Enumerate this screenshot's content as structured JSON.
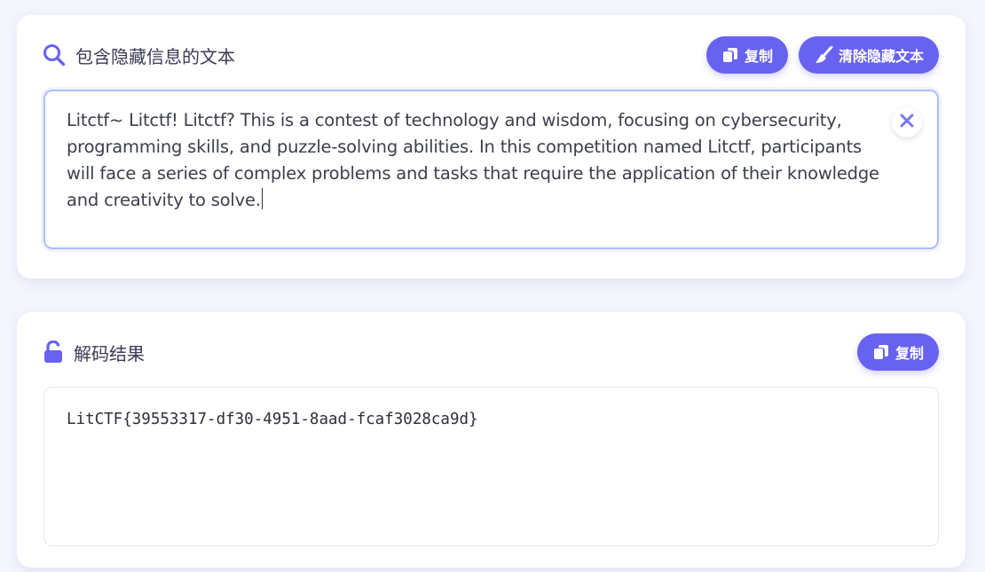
{
  "input_card": {
    "title": "包含隐藏信息的文本",
    "title_icon": "search-icon",
    "copy_label": "复制",
    "clear_hidden_label": "清除隐藏文本",
    "text": "Litctf~ Litctf! Litctf? This is a contest of technology and wisdom, focusing on cybersecurity, programming skills, and puzzle-solving abilities. In this competition named Litctf, participants will face a series of complex problems and tasks that require the application of their knowledge and creativity to solve."
  },
  "result_card": {
    "title": "解码结果",
    "title_icon": "unlock-icon",
    "copy_label": "复制",
    "result": "LitCTF{39553317-df30-4951-8aad-fcaf3028ca9d}"
  },
  "colors": {
    "accent": "#6762f0",
    "focus_border": "#aebdfc",
    "background": "#f3f6fd"
  }
}
